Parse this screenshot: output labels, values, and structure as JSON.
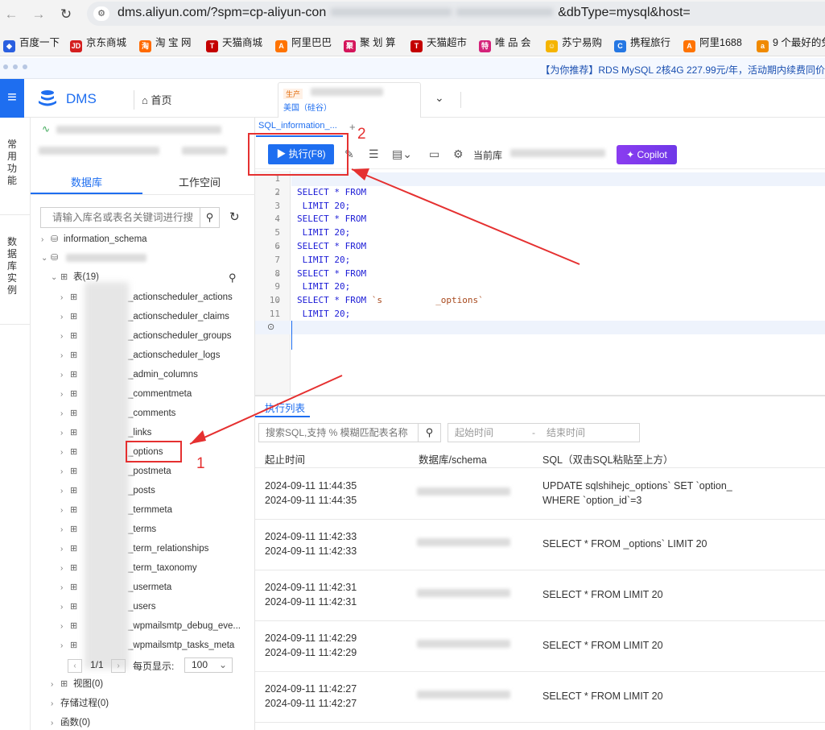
{
  "browser": {
    "url": "dms.aliyun.com/?spm=cp-aliyun-con",
    "url_tail": "&dbType=mysql&host=",
    "bookmarks": [
      "百度一下",
      "京东商城",
      "淘 宝 网",
      "天猫商城",
      "阿里巴巴",
      "聚 划 算",
      "天猫超市",
      "唯 品 会",
      "苏宁易购",
      "携程旅行",
      "阿里1688",
      "9 个最好的免"
    ],
    "promo": "【为你推荐】RDS MySQL 2核4G 227.99元/年，活动期内续费同价"
  },
  "header": {
    "app_title": "DMS",
    "home": "首页",
    "env_tag": "生产",
    "region": "美国（硅谷）"
  },
  "rail": {
    "item1": "常用功能",
    "item2": "数据库实例"
  },
  "sidebar": {
    "tab_database": "数据库",
    "tab_workspace": "工作空间",
    "search_placeholder": "请输入库名或表名关键词进行搜",
    "schema1": "information_schema",
    "tables_label": "表(19)",
    "tables": [
      "_actionscheduler_actions",
      "_actionscheduler_claims",
      "_actionscheduler_groups",
      "_actionscheduler_logs",
      "_admin_columns",
      "_commentmeta",
      "_comments",
      "_links",
      "_options",
      "_postmeta",
      "_posts",
      "_termmeta",
      "_terms",
      "_term_relationships",
      "_term_taxonomy",
      "_usermeta",
      "_users",
      "_wpmailsmtp_debug_eve...",
      "_wpmailsmtp_tasks_meta"
    ],
    "pager_text": "1/1",
    "page_size_label": "每页显示:",
    "page_size": "100",
    "views": "视图(0)",
    "procedures": "存储过程(0)",
    "functions": "函数(0)"
  },
  "editor": {
    "tab_label": "SQL_information_...",
    "run_button": "执行(F8)",
    "current_db_label": "当前库",
    "copilot": "Copilot",
    "line_numbers": [
      "1",
      "2",
      "3",
      "4",
      "5",
      "6",
      "7",
      "8",
      "9",
      "10",
      "11"
    ],
    "lines": [
      "",
      "SELECT * FROM",
      " LIMIT 20;",
      "SELECT * FROM",
      " LIMIT 20;",
      "SELECT * FROM",
      " LIMIT 20;",
      "SELECT * FROM",
      " LIMIT 20;",
      "SELECT * FROM ",
      " LIMIT 20;"
    ],
    "line10_table": "`s          _options`"
  },
  "results": {
    "tab_label": "执行列表",
    "search_placeholder": "搜索SQL,支持 % 模糊匹配表名称",
    "start_placeholder": "起始时间",
    "range_sep": "-",
    "end_placeholder": "结束时间",
    "columns": [
      "起止时间",
      "数据库/schema",
      "SQL（双击SQL粘贴至上方）"
    ],
    "rows": [
      {
        "start": "2024-09-11 11:44:35",
        "end": "2024-09-11 11:44:35",
        "db": "",
        "sql1": "UPDATE                              sqlshihejc_options` SET `option_",
        "sql2": "WHERE `option_id`=3"
      },
      {
        "start": "2024-09-11 11:42:33",
        "end": "2024-09-11 11:42:33",
        "db": "",
        "sql1": "SELECT * FROM                _options` LIMIT 20",
        "sql2": ""
      },
      {
        "start": "2024-09-11 11:42:31",
        "end": "2024-09-11 11:42:31",
        "db": "",
        "sql1": "SELECT * FROM LIMIT 20",
        "sql2": ""
      },
      {
        "start": "2024-09-11 11:42:29",
        "end": "2024-09-11 11:42:29",
        "db": "",
        "sql1": "SELECT * FROM LIMIT 20",
        "sql2": ""
      },
      {
        "start": "2024-09-11 11:42:27",
        "end": "2024-09-11 11:42:27",
        "db": "",
        "sql1": "SELECT * FROM LIMIT 20",
        "sql2": ""
      }
    ]
  },
  "annotations": {
    "label1": "1",
    "label2": "2",
    "color": "#e53030"
  },
  "colors": {
    "accent": "#1e6ef0",
    "copilot": "#7b3aed",
    "annotation": "#e53030"
  }
}
